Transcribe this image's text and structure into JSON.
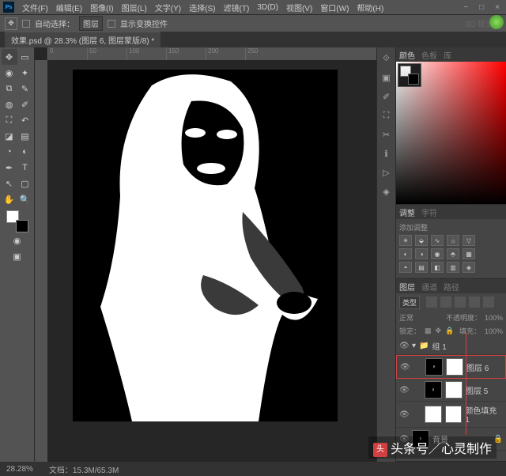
{
  "menu": {
    "items": [
      "文件(F)",
      "编辑(E)",
      "图像(I)",
      "图层(L)",
      "文字(Y)",
      "选择(S)",
      "滤镜(T)",
      "3D(D)",
      "视图(V)",
      "窗口(W)",
      "帮助(H)"
    ]
  },
  "options": {
    "auto_select": "自动选择：",
    "group": "图层",
    "show_controls": "显示变换控件",
    "mode3d": "3D 模式："
  },
  "tab": {
    "label": "效果.psd @ 28.3% (图层 6, 图层蒙版/8) *"
  },
  "ruler": {
    "marks": [
      "0",
      "50",
      "100",
      "150",
      "200",
      "250"
    ]
  },
  "panels": {
    "color": {
      "tab1": "颜色",
      "tab2": "色板",
      "tab3": "库"
    },
    "adjust": {
      "tab1": "调整",
      "tab2": "字符",
      "label": "添加调整"
    },
    "layers": {
      "tab1": "图层",
      "tab2": "通道",
      "tab3": "路径",
      "kind": "类型",
      "blend": "正常",
      "opacity_lbl": "不透明度：",
      "opacity_val": "100%",
      "lock": "锁定：",
      "fill_lbl": "填充：",
      "fill_val": "100%",
      "items": [
        {
          "name": "组 1",
          "type": "group"
        },
        {
          "name": "图层 6",
          "type": "mask",
          "selected": true
        },
        {
          "name": "图层 5",
          "type": "mask"
        },
        {
          "name": "颜色填充 1",
          "type": "fill"
        },
        {
          "name": "背景",
          "type": "bg"
        }
      ]
    }
  },
  "status": {
    "zoom": "28.28%",
    "doc": "文档：15.3M/65.3M"
  },
  "watermark": "头条号／心灵制作"
}
